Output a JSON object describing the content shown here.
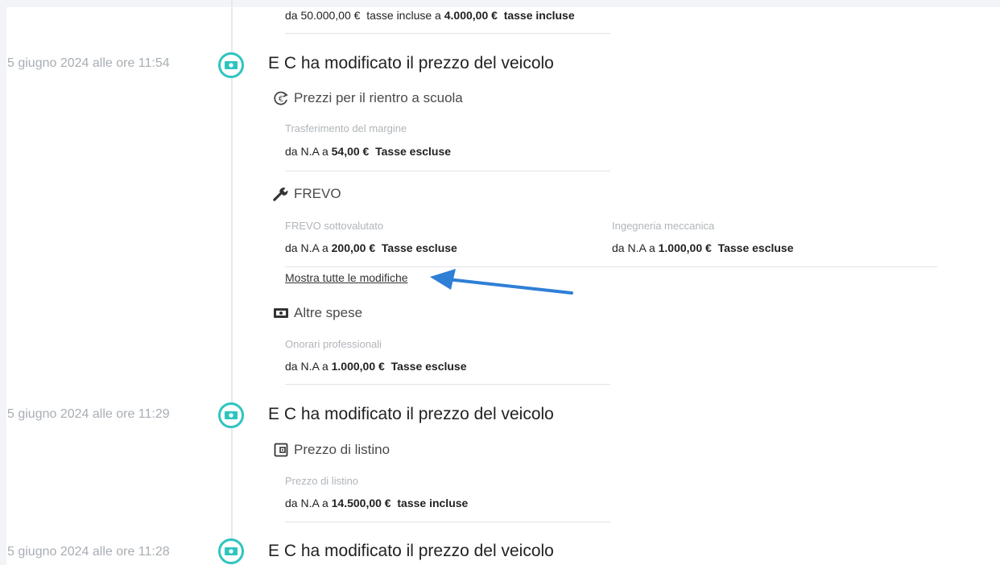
{
  "top_change": {
    "from_word": "da",
    "from_value": "50.000,00 €",
    "from_suffix": "tasse incluse",
    "to_word": "a",
    "to_value": "4.000,00 €",
    "to_suffix": "tasse incluse"
  },
  "events": [
    {
      "timestamp": "5 giugno 2024 alle ore 11:54",
      "title": "E C ha modificato il prezzo del veicolo",
      "sections": [
        {
          "title": "Prezzi per il rientro a scuola",
          "icon": "euro-refresh-icon",
          "items": [
            {
              "label": "Trasferimento del margine",
              "from_word": "da",
              "from": "N.A",
              "to_word": "a",
              "to": "54,00 €",
              "suffix": "Tasse escluse"
            }
          ]
        },
        {
          "title": "FREVO",
          "icon": "wrench-icon",
          "items": [
            {
              "label": "FREVO sottovalutato",
              "from_word": "da",
              "from": "N.A",
              "to_word": "a",
              "to": "200,00 €",
              "suffix": "Tasse escluse"
            },
            {
              "label": "Ingegneria meccanica",
              "from_word": "da",
              "from": "N.A",
              "to_word": "a",
              "to": "1.000,00 €",
              "suffix": "Tasse escluse"
            }
          ],
          "show_all_link": "Mostra tutte le modifiche"
        },
        {
          "title": "Altre spese",
          "icon": "cash-icon",
          "items": [
            {
              "label": "Onorari professionali",
              "from_word": "da",
              "from": "N.A",
              "to_word": "a",
              "to": "1.000,00 €",
              "suffix": "Tasse escluse"
            }
          ]
        }
      ]
    },
    {
      "timestamp": "5 giugno 2024 alle ore 11:29",
      "title": "E C ha modificato il prezzo del veicolo",
      "sections": [
        {
          "title": "Prezzo di listino",
          "icon": "price-tag-icon",
          "items": [
            {
              "label": "Prezzo di listino",
              "from_word": "da",
              "from": "N.A",
              "to_word": "a",
              "to": "14.500,00 €",
              "suffix": "tasse incluse"
            }
          ]
        }
      ]
    },
    {
      "timestamp": "5 giugno 2024 alle ore 11:28",
      "title": "E C ha modificato il prezzo del veicolo",
      "sections": []
    }
  ],
  "colors": {
    "accent": "#2ec5bf",
    "annotation_arrow": "#2f7fd6",
    "muted_text": "#a8aeb4"
  }
}
